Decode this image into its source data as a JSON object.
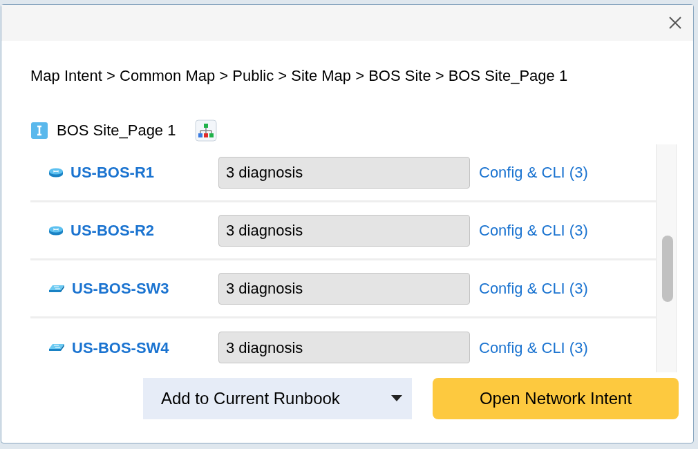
{
  "breadcrumb": "Map Intent > Common Map > Public > Site Map > BOS Site > BOS Site_Page 1",
  "page": {
    "title": "BOS Site_Page 1"
  },
  "devices": [
    {
      "kind": "router",
      "name": "US-BOS-R1",
      "diagnosis": "3 diagnosis",
      "link": "Config & CLI (3)"
    },
    {
      "kind": "router",
      "name": "US-BOS-R2",
      "diagnosis": "3 diagnosis",
      "link": "Config & CLI (3)"
    },
    {
      "kind": "switch",
      "name": "US-BOS-SW3",
      "diagnosis": "3 diagnosis",
      "link": "Config & CLI (3)"
    },
    {
      "kind": "switch",
      "name": "US-BOS-SW4",
      "diagnosis": "3 diagnosis",
      "link": "Config & CLI (3)"
    }
  ],
  "buttons": {
    "add": "Add to Current Runbook",
    "open": "Open Network Intent"
  }
}
